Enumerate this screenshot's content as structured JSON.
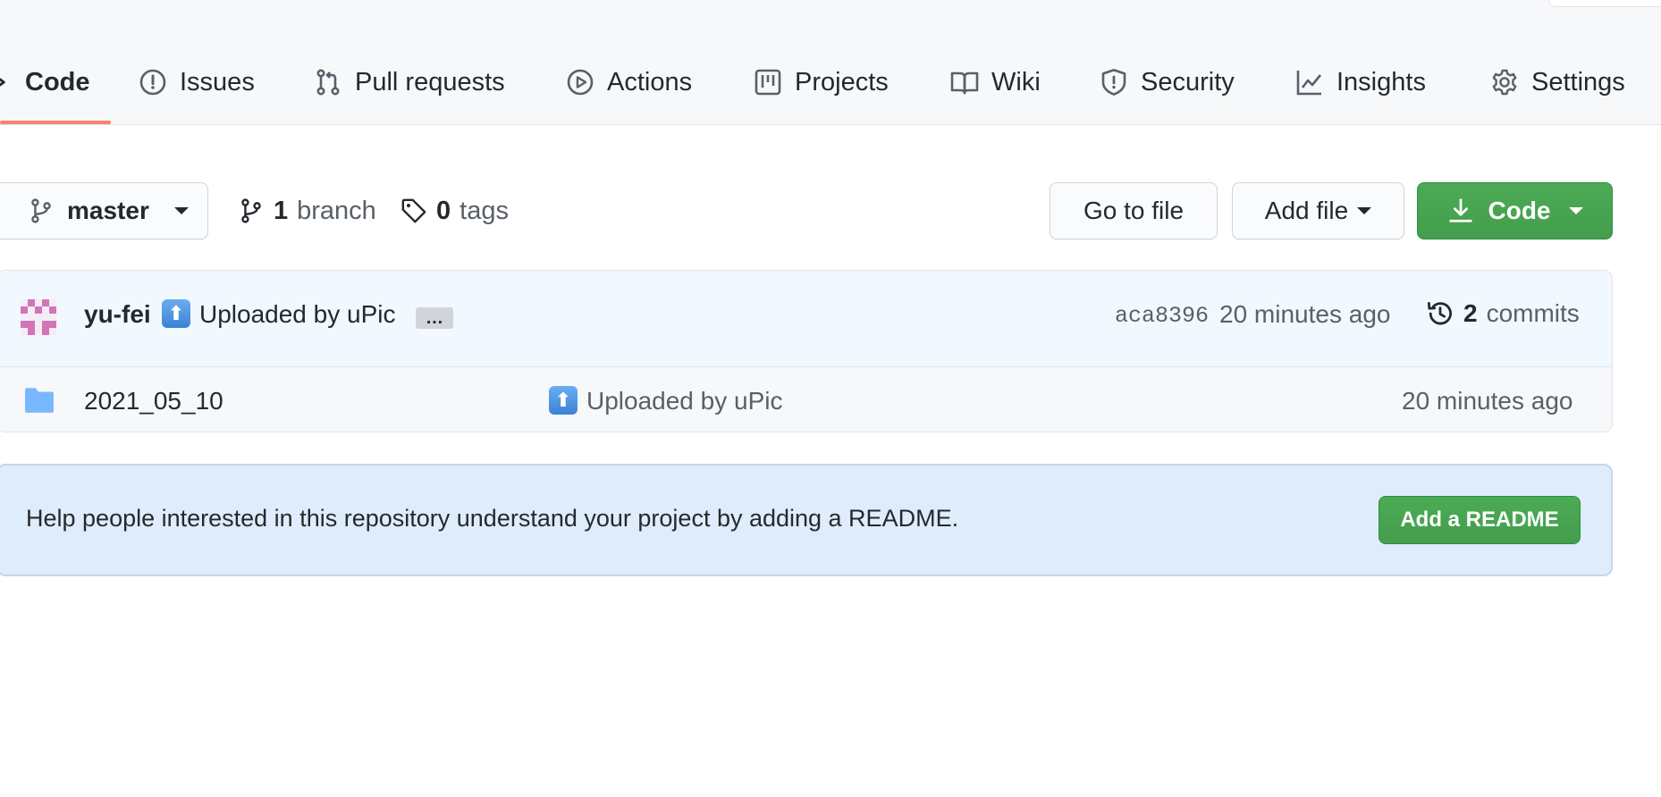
{
  "tabs": [
    {
      "label": "Code",
      "icon": "code-icon"
    },
    {
      "label": "Issues",
      "icon": "issue-icon"
    },
    {
      "label": "Pull requests",
      "icon": "pull-request-icon"
    },
    {
      "label": "Actions",
      "icon": "play-icon"
    },
    {
      "label": "Projects",
      "icon": "project-icon"
    },
    {
      "label": "Wiki",
      "icon": "book-icon"
    },
    {
      "label": "Security",
      "icon": "shield-icon"
    },
    {
      "label": "Insights",
      "icon": "graph-icon"
    },
    {
      "label": "Settings",
      "icon": "gear-icon"
    }
  ],
  "active_tab": "Code",
  "branch_bar": {
    "branch_name": "master",
    "branch_count": "1",
    "branch_word": "branch",
    "tag_count": "0",
    "tag_word": "tags",
    "go_to_file": "Go to file",
    "add_file": "Add file",
    "code_button": "Code"
  },
  "latest_commit": {
    "author": "yu-fei",
    "emoji": "⬆",
    "message": "Uploaded by uPic",
    "ellipsis": "…",
    "sha": "aca8396",
    "time": "20 minutes ago",
    "commit_count": "2",
    "commit_word": "commits"
  },
  "files": [
    {
      "type": "folder",
      "name": "2021_05_10",
      "emoji": "⬆",
      "message": "Uploaded by uPic",
      "time": "20 minutes ago"
    }
  ],
  "readme_prompt": {
    "text": "Help people interested in this repository understand your project by adding a README.",
    "button": "Add a README"
  },
  "colors": {
    "accent_underline": "#f9826c",
    "primary_green": "#2ea44f",
    "commit_row_bg": "#f1f8ff",
    "readme_bg": "#dfecfb",
    "folder_blue": "#79b8ff"
  }
}
